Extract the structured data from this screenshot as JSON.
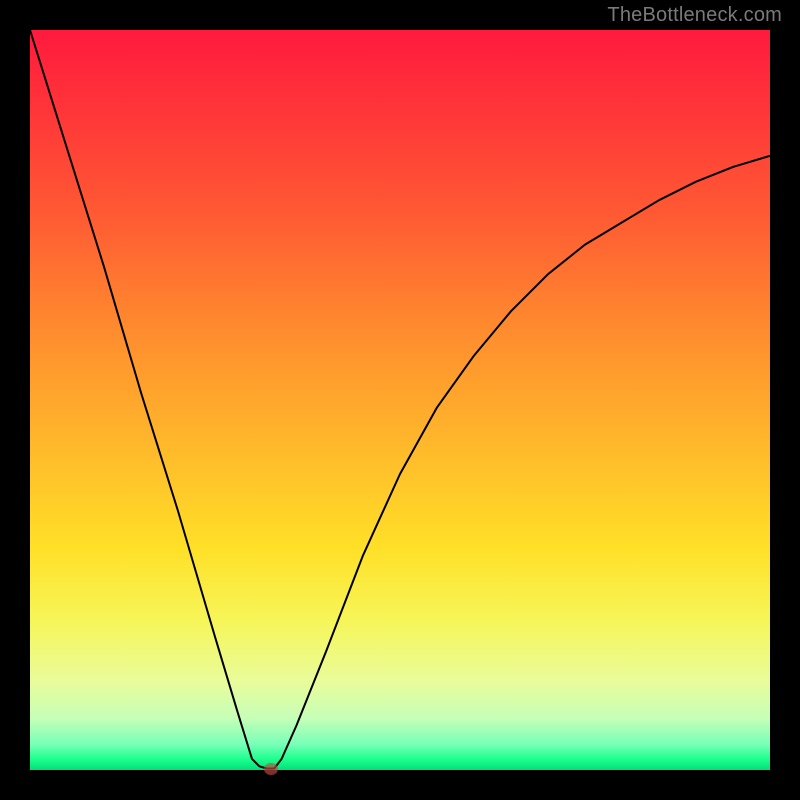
{
  "watermark": "TheBottleneck.com",
  "colors": {
    "black": "#000000",
    "curve": "#000000",
    "dot": "rgba(190,75,65,0.65)"
  },
  "gradient_stops": [
    {
      "offset": 0.0,
      "color": "#ff1a3e"
    },
    {
      "offset": 0.12,
      "color": "#ff3838"
    },
    {
      "offset": 0.25,
      "color": "#ff5a33"
    },
    {
      "offset": 0.4,
      "color": "#ff8a2e"
    },
    {
      "offset": 0.55,
      "color": "#ffb52b"
    },
    {
      "offset": 0.7,
      "color": "#ffe027"
    },
    {
      "offset": 0.8,
      "color": "#f6f65a"
    },
    {
      "offset": 0.88,
      "color": "#e9fc9a"
    },
    {
      "offset": 0.93,
      "color": "#c6ffb8"
    },
    {
      "offset": 0.965,
      "color": "#78ffb8"
    },
    {
      "offset": 0.985,
      "color": "#1eff8e"
    },
    {
      "offset": 1.0,
      "color": "#00e07a"
    }
  ],
  "chart_data": {
    "type": "line",
    "title": "",
    "xlabel": "",
    "ylabel": "",
    "xlim": [
      0,
      100
    ],
    "ylim": [
      0,
      100
    ],
    "series": [
      {
        "name": "bottleneck-curve",
        "x": [
          0,
          5,
          10,
          15,
          20,
          25,
          28,
          30,
          31,
          32,
          33,
          34,
          36,
          40,
          45,
          50,
          55,
          60,
          65,
          70,
          75,
          80,
          85,
          90,
          95,
          100
        ],
        "y": [
          100,
          84,
          68,
          51,
          35,
          18,
          8,
          1.5,
          0.5,
          0.2,
          0.2,
          1.5,
          6,
          16,
          29,
          40,
          49,
          56,
          62,
          67,
          71,
          74,
          77,
          79.5,
          81.5,
          83
        ]
      }
    ],
    "annotations": [
      {
        "name": "vertex-dot",
        "x": 32.5,
        "y": 0.2
      }
    ],
    "grid": false,
    "legend": false
  }
}
